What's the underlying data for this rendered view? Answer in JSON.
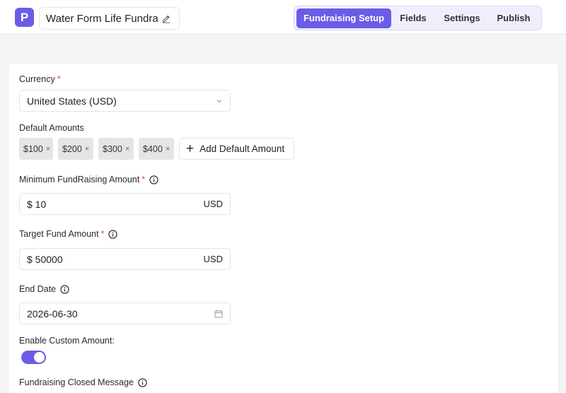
{
  "header": {
    "logo_letter": "P",
    "form_title": "Water Form Life Fundraisi",
    "tabs": [
      {
        "label": "Fundraising Setup",
        "active": true
      },
      {
        "label": "Fields",
        "active": false
      },
      {
        "label": "Settings",
        "active": false
      },
      {
        "label": "Publish",
        "active": false
      }
    ]
  },
  "form": {
    "currency": {
      "label": "Currency",
      "required": "*",
      "value": "United States (USD)"
    },
    "default_amounts": {
      "label": "Default Amounts",
      "chips": [
        "$100",
        "$200",
        "$300",
        "$400"
      ],
      "remove_glyph": "×",
      "add_label": "Add Default Amount",
      "add_glyph": "+"
    },
    "minimum_amount": {
      "label": "Minimum FundRaising Amount",
      "required": "*",
      "value": "$ 10",
      "unit": "USD"
    },
    "target_amount": {
      "label": "Target Fund Amount",
      "required": "*",
      "value": "$ 50000",
      "unit": "USD"
    },
    "end_date": {
      "label": "End Date",
      "value": "2026-06-30"
    },
    "custom_amount": {
      "label": "Enable Custom Amount:",
      "enabled": true
    },
    "closed_message": {
      "label": "Fundraising Closed Message"
    }
  },
  "colors": {
    "accent": "#6b5ce7",
    "required": "#e5484d"
  },
  "icons": [
    "pencil-icon",
    "chevron-down-icon",
    "info-icon",
    "calendar-icon",
    "plus-icon",
    "close-icon"
  ]
}
